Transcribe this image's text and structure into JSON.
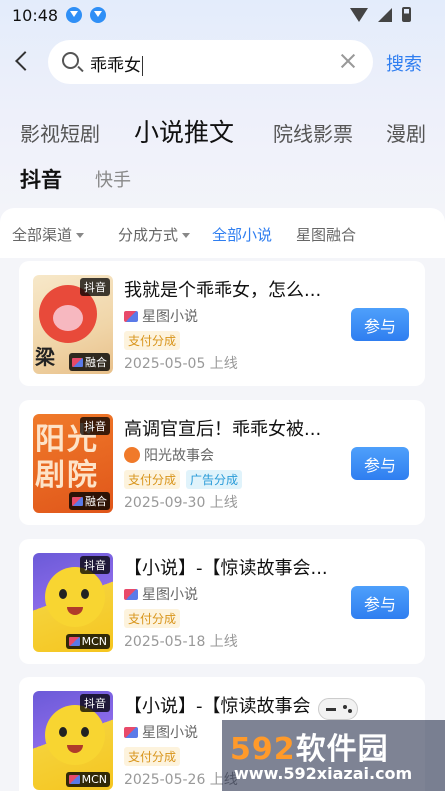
{
  "status_bar": {
    "time": "10:48"
  },
  "search": {
    "query": "乖乖女",
    "button_label": "搜索"
  },
  "category_tabs": [
    {
      "label": "影视短剧",
      "active": false
    },
    {
      "label": "小说推文",
      "active": true
    },
    {
      "label": "院线影票",
      "active": false
    },
    {
      "label": "漫剧",
      "active": false
    }
  ],
  "platform_tabs": [
    {
      "label": "抖音",
      "active": true
    },
    {
      "label": "快手",
      "active": false
    }
  ],
  "filters": [
    {
      "label": "全部渠道",
      "dropdown": true
    },
    {
      "label": "分成方式",
      "dropdown": true
    },
    {
      "label": "全部小说",
      "dropdown": false,
      "selected": true
    },
    {
      "label": "星图融合",
      "dropdown": false
    }
  ],
  "cards": [
    {
      "title": "我就是个乖乖女，怎么...",
      "source": "星图小说",
      "tags": [
        "支付分成"
      ],
      "date": "2025-05-05 上线",
      "badge_top": "抖音",
      "badge_bottom": "融合",
      "action": "参与",
      "thumb_style": "tomato",
      "thumb_caption": "梁"
    },
    {
      "title": "高调官宣后！乖乖女被...",
      "source": "阳光故事会",
      "tags": [
        "支付分成",
        "广告分成"
      ],
      "date": "2025-09-30 上线",
      "badge_top": "抖音",
      "badge_bottom": "融合",
      "action": "参与",
      "thumb_style": "sunshine",
      "thumb_caption": "阳光剧院"
    },
    {
      "title": "【小说】-【惊读故事会...",
      "source": "星图小说",
      "tags": [
        "支付分成"
      ],
      "date": "2025-05-18 上线",
      "badge_top": "抖音",
      "badge_bottom": "MCN",
      "action": "参与",
      "thumb_style": "yellow"
    },
    {
      "title": "【小说】-【惊读故事会",
      "source": "星图小说",
      "tags": [
        "支付分成"
      ],
      "date": "2025-05-26 上线",
      "badge_top": "抖音",
      "badge_bottom": "MCN",
      "action": "参与",
      "thumb_style": "yellow"
    }
  ],
  "watermark": {
    "brand_num": "592",
    "brand_text": "软件园",
    "url": "www.592xiazai.com"
  },
  "colors": {
    "accent": "#2f7ef0",
    "pay_tag": "#d8941a",
    "ad_tag": "#2a9bd8"
  }
}
